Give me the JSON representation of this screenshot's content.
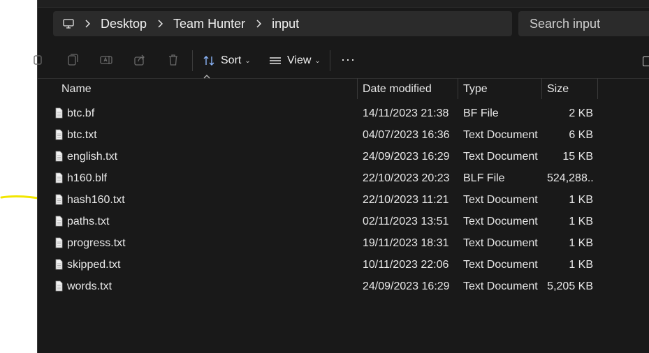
{
  "breadcrumb": [
    "Desktop",
    "Team Hunter",
    "input"
  ],
  "search_placeholder": "Search input",
  "toolbar": {
    "sort_label": "Sort",
    "view_label": "View",
    "more_label": "···"
  },
  "columns": {
    "name": "Name",
    "date": "Date modified",
    "type": "Type",
    "size": "Size"
  },
  "files": [
    {
      "name": "btc.bf",
      "date": "14/11/2023 21:38",
      "type": "BF File",
      "size": "2 KB"
    },
    {
      "name": "btc.txt",
      "date": "04/07/2023 16:36",
      "type": "Text Document",
      "size": "6 KB"
    },
    {
      "name": "english.txt",
      "date": "24/09/2023 16:29",
      "type": "Text Document",
      "size": "15 KB"
    },
    {
      "name": "h160.blf",
      "date": "22/10/2023 20:23",
      "type": "BLF File",
      "size": "524,288..."
    },
    {
      "name": "hash160.txt",
      "date": "22/10/2023 11:21",
      "type": "Text Document",
      "size": "1 KB"
    },
    {
      "name": "paths.txt",
      "date": "02/11/2023 13:51",
      "type": "Text Document",
      "size": "1 KB"
    },
    {
      "name": "progress.txt",
      "date": "19/11/2023 18:31",
      "type": "Text Document",
      "size": "1 KB"
    },
    {
      "name": "skipped.txt",
      "date": "10/11/2023 22:06",
      "type": "Text Document",
      "size": "1 KB"
    },
    {
      "name": "words.txt",
      "date": "24/09/2023 16:29",
      "type": "Text Document",
      "size": "5,205 KB"
    }
  ],
  "colors": {
    "background": "#191919",
    "field": "#2b2b2b",
    "annotation": "#f2e600"
  }
}
